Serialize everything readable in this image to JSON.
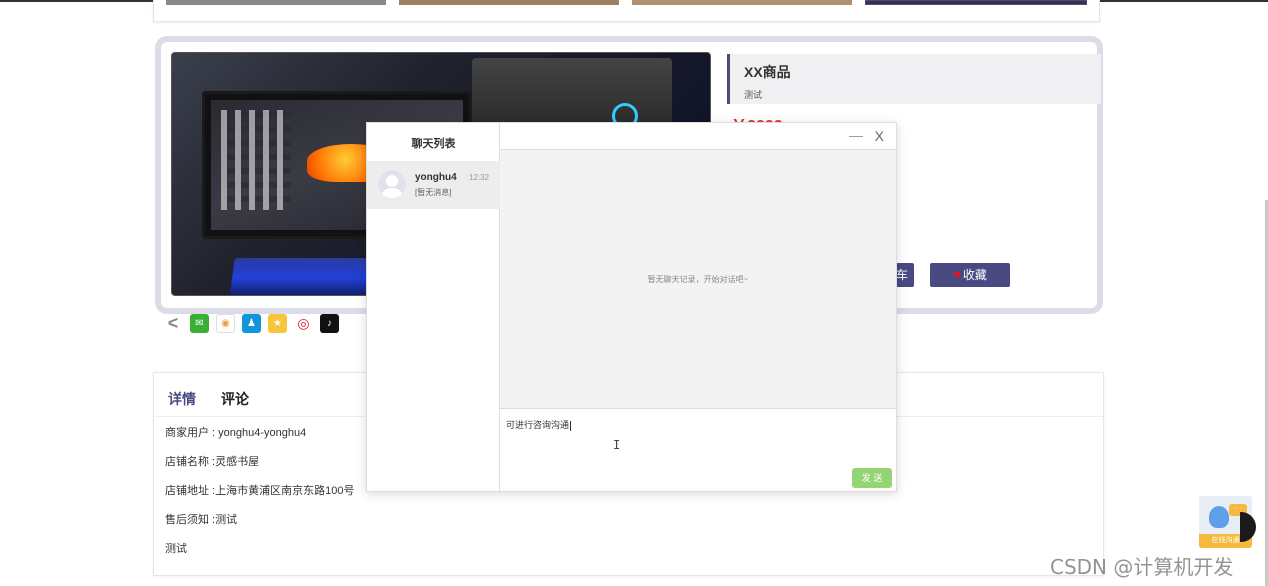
{
  "product": {
    "title": "XX商品",
    "subtitle": "测试",
    "price": "￥2222",
    "buttons": {
      "left_partial": "车",
      "favorite": "收藏"
    }
  },
  "share_icons": [
    "share-icon",
    "wechat-icon",
    "moments-icon",
    "qq-icon",
    "qzone-icon",
    "weibo-icon",
    "douyin-icon"
  ],
  "detail": {
    "tabs": [
      "详情",
      "评论"
    ],
    "lines": [
      "商家用户 : yonghu4-yonghu4",
      "店铺名称 :灵感书屋",
      "店铺地址 :上海市黄浦区南京东路100号",
      "售后须知 :测试",
      "测试"
    ]
  },
  "chat": {
    "list_title": "聊天列表",
    "contacts": [
      {
        "name": "yonghu4",
        "time": "12:32",
        "last_msg": "[暂无消息]"
      }
    ],
    "minimize": "—",
    "close": "X",
    "empty_text": "暂无聊天记录，开始对话吧~",
    "input_value": "可进行咨询沟通",
    "send_label": "发 送"
  },
  "online_widget": {
    "label": "在线沟通",
    "bubble": "···"
  },
  "watermark": "CSDN @计算机开发",
  "colors": {
    "accent": "#4a4a82",
    "price": "#e0303a",
    "send": "#95d475"
  }
}
